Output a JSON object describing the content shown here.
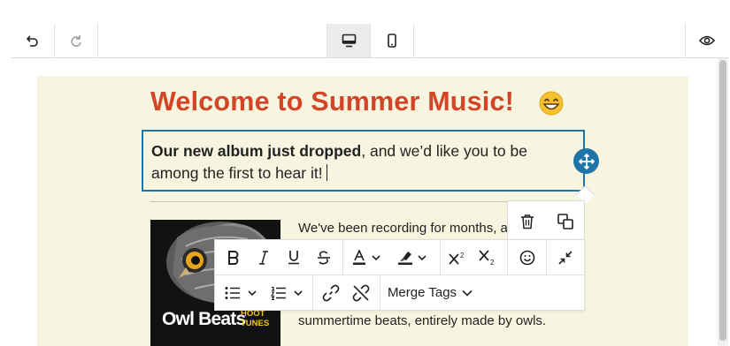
{
  "topbar": {
    "undo_icon": "undo-icon",
    "redo_icon": "redo-icon",
    "desktop_icon": "desktop-icon",
    "mobile_icon": "mobile-icon",
    "preview_icon": "eye-icon",
    "active_view": "desktop"
  },
  "email": {
    "headline": "Welcome to Summer Music!",
    "headline_emoji": "😄",
    "intro_bold": "Our new album just dropped",
    "intro_rest": ", and we’d like you to be among the first to hear it!",
    "image_title": "Owl Beats",
    "image_subtitle_1": "HOOT",
    "image_subtitle_2": "TUNES",
    "body_line_1": "We've been recording for months, a",
    "body_line_2": "summertime beats, entirely made by owls."
  },
  "block_actions": {
    "delete_icon": "trash-icon",
    "duplicate_icon": "duplicate-icon",
    "move_icon": "move-icon"
  },
  "format_toolbar": {
    "row1": [
      "bold-icon",
      "italic-icon",
      "underline-icon",
      "strikethrough-icon",
      "font-color-icon",
      "highlight-icon",
      "superscript-icon",
      "subscript-icon",
      "emoji-icon",
      "collapse-icon"
    ],
    "row2": [
      "bullet-list-icon",
      "numbered-list-icon",
      "link-icon",
      "unlink-icon"
    ],
    "merge_tags_label": "Merge Tags",
    "accent_color": "#1f75a8",
    "headline_color": "#d44426",
    "canvas_color": "#f7f5df"
  }
}
